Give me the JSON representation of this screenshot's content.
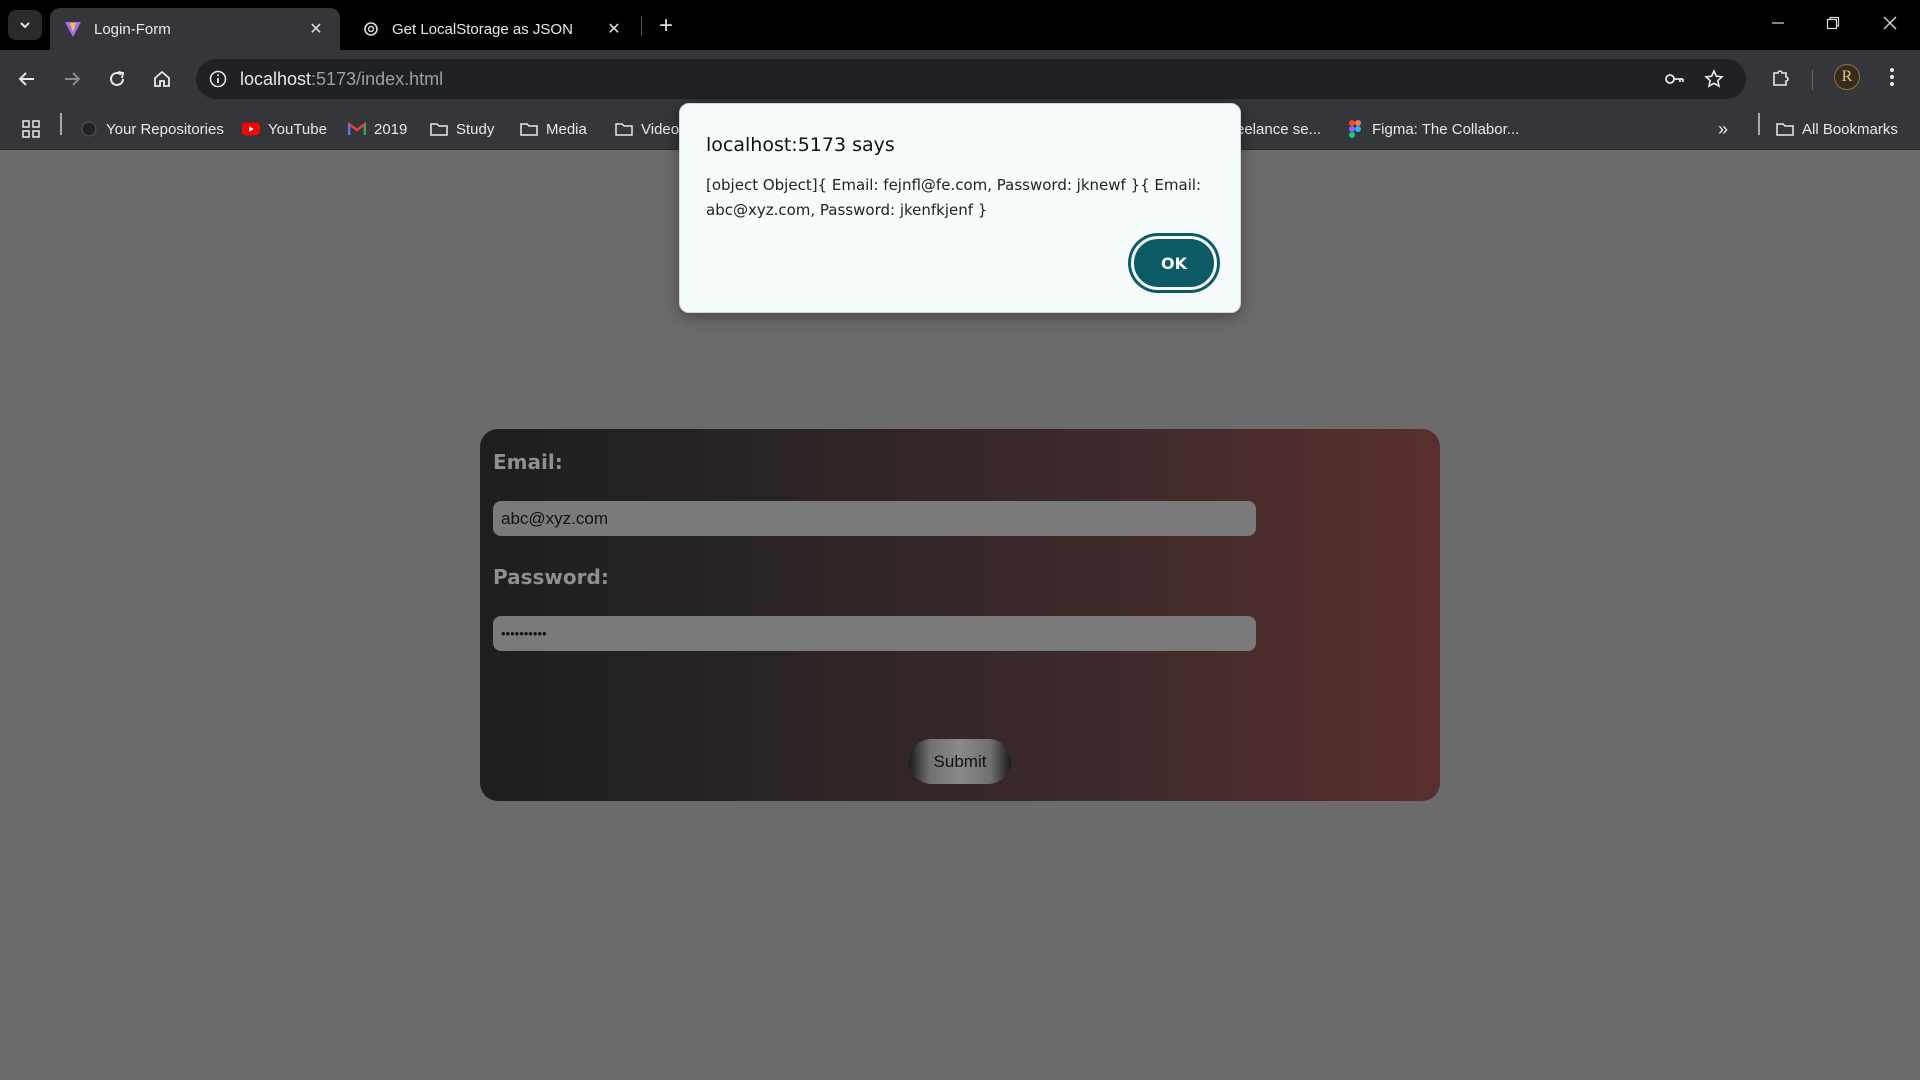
{
  "browser": {
    "tabs": [
      {
        "title": "Login-Form",
        "active": true,
        "icon": "vite-icon"
      },
      {
        "title": "Get LocalStorage as JSON",
        "active": false,
        "icon": "openai-icon"
      }
    ],
    "url_host": "localhost",
    "url_path": ":5173/index.html"
  },
  "bookmarks": [
    {
      "label": "Your Repositories",
      "icon": "github-icon"
    },
    {
      "label": "YouTube",
      "icon": "youtube-icon"
    },
    {
      "label": "2019",
      "icon": "gmail-icon"
    },
    {
      "label": "Study",
      "icon": "folder-icon"
    },
    {
      "label": "Media",
      "icon": "folder-icon"
    },
    {
      "label": "Video",
      "icon": "folder-icon"
    },
    {
      "label": "eelance se...",
      "icon": "folder-icon"
    },
    {
      "label": "Figma: The Collabor...",
      "icon": "figma-icon"
    }
  ],
  "bookmarks_all": "All Bookmarks",
  "avatar_letter": "R",
  "form": {
    "email_label": "Email:",
    "email_value": "abc@xyz.com",
    "password_label": "Password:",
    "password_value": "••••••••••",
    "submit_label": "Submit"
  },
  "alert": {
    "title": "localhost:5173 says",
    "message": "[object Object]{ Email: fejnfl@fe.com, Password: jknewf }{ Email: abc@xyz.com, Password: jkenfkjenf }",
    "ok_label": "OK"
  },
  "colors": {
    "page_bg": "#6b6b6b",
    "ok_button": "#0c5a66",
    "card_gradient_start": "#1e1e1e",
    "card_gradient_end": "#5a2e2e"
  }
}
